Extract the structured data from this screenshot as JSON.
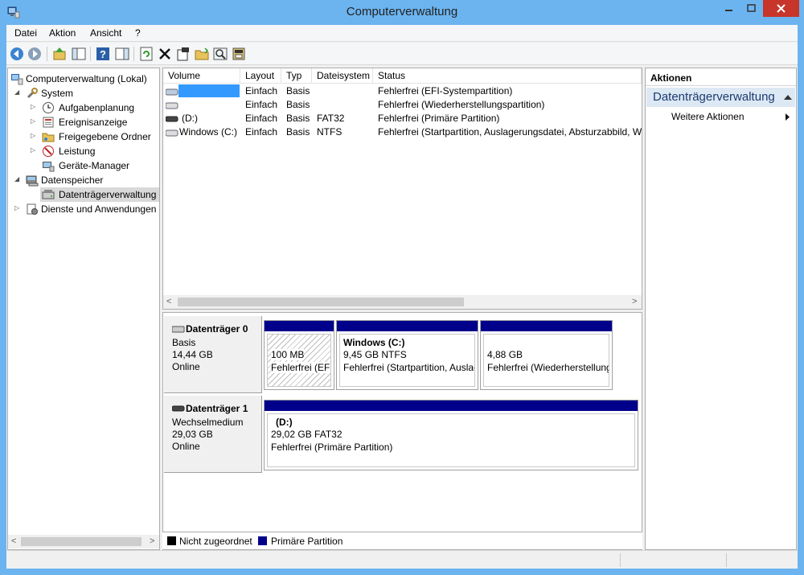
{
  "window": {
    "title": "Computerverwaltung"
  },
  "menu": [
    "Datei",
    "Aktion",
    "Ansicht",
    "?"
  ],
  "toolbar": [
    "back-icon",
    "forward-icon",
    "up-icon",
    "show-hide-tree-icon",
    "help-icon",
    "properties-pane-icon",
    "refresh-icon",
    "delete-icon",
    "properties-icon",
    "open-folder-icon",
    "search-icon",
    "disk-icon"
  ],
  "tree": {
    "root": "Computerverwaltung (Lokal)",
    "system": "System",
    "aufgabenplanung": "Aufgabenplanung",
    "ereignisanzeige": "Ereignisanzeige",
    "freigegebene": "Freigegebene Ordner",
    "leistung": "Leistung",
    "geraete": "Geräte-Manager",
    "datenspeicher": "Datenspeicher",
    "datentraegerverwaltung": "Datenträgerverwaltung",
    "dienste": "Dienste und Anwendungen"
  },
  "volumes": {
    "columns": [
      "Volume",
      "Layout",
      "Typ",
      "Dateisystem",
      "Status"
    ],
    "rows": [
      {
        "volume": "",
        "layout": "Einfach",
        "typ": "Basis",
        "fs": "",
        "status": "Fehlerfrei (EFI-Systempartition)"
      },
      {
        "volume": "",
        "layout": "Einfach",
        "typ": "Basis",
        "fs": "",
        "status": "Fehlerfrei (Wiederherstellungspartition)"
      },
      {
        "volume": "(D:)",
        "layout": "Einfach",
        "typ": "Basis",
        "fs": "FAT32",
        "status": "Fehlerfrei (Primäre Partition)"
      },
      {
        "volume": "Windows (C:)",
        "layout": "Einfach",
        "typ": "Basis",
        "fs": "NTFS",
        "status": "Fehlerfrei (Startpartition, Auslagerungsdatei, Absturzabbild, Wi"
      }
    ]
  },
  "disks": [
    {
      "name": "Datenträger 0",
      "type": "Basis",
      "size": "14,44 GB",
      "state": "Online",
      "partitions": [
        {
          "title": "",
          "size": "100 MB",
          "status": "Fehlerfrei (EFI-"
        },
        {
          "title": "Windows  (C:)",
          "size": "9,45 GB NTFS",
          "status": "Fehlerfrei (Startpartition, Auslag"
        },
        {
          "title": "",
          "size": "4,88 GB",
          "status": "Fehlerfrei (Wiederherstellung"
        }
      ]
    },
    {
      "name": "Datenträger 1",
      "type": "Wechselmedium",
      "size": "29,03 GB",
      "state": "Online",
      "partitions": [
        {
          "title": "(D:)",
          "size": "29,02 GB FAT32",
          "status": "Fehlerfrei (Primäre Partition)"
        }
      ]
    }
  ],
  "legend": {
    "unallocated": "Nicht zugeordnet",
    "primary": "Primäre Partition",
    "unallocated_color": "#000000",
    "primary_color": "#00008b"
  },
  "actions": {
    "header": "Aktionen",
    "section": "Datenträgerverwaltung",
    "more": "Weitere Aktionen"
  }
}
